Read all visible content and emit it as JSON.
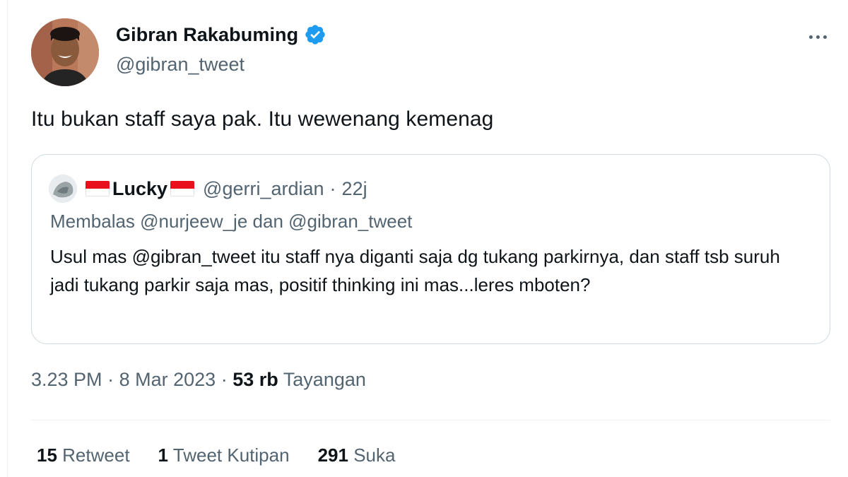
{
  "author": {
    "display_name": "Gibran Rakabuming",
    "handle": "@gibran_tweet",
    "verified_icon": "verified-badge-icon"
  },
  "tweet": {
    "text": "Itu bukan staff saya pak. Itu wewenang kemenag"
  },
  "quoted": {
    "name": "Lucky",
    "handle": "@gerri_ardian",
    "separator": "·",
    "age": "22j",
    "reply_to": "Membalas @nurjeew_je dan @gibran_tweet",
    "body": "Usul mas @gibran_tweet itu staff nya diganti saja dg tukang parkirnya, dan staff tsb suruh jadi tukang parkir saja mas, positif thinking ini mas...leres mboten?"
  },
  "meta": {
    "time": "3.23 PM",
    "date": "8 Mar 2023",
    "views_count": "53 rb",
    "views_label": "Tayangan",
    "separator": "·"
  },
  "stats": {
    "retweets_count": "15",
    "retweets_label": "Retweet",
    "quotes_count": "1",
    "quotes_label": "Tweet Kutipan",
    "likes_count": "291",
    "likes_label": "Suka"
  },
  "colors": {
    "verified_blue": "#1d9bf0",
    "secondary_text": "#536471",
    "border": "#cfd9de",
    "flag_red": "#e8101d"
  }
}
